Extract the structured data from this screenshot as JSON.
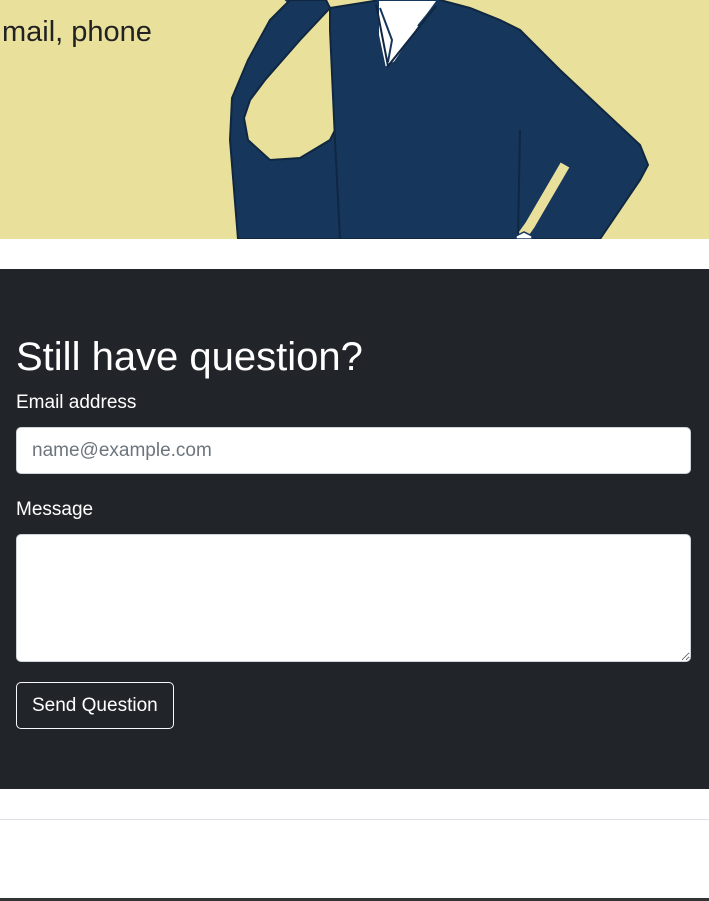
{
  "hero": {
    "text": "mail, phone",
    "illustration_icon": "businessman-on-phone-illustration",
    "colors": {
      "background": "#e9e09c",
      "suit": "#17365b"
    }
  },
  "question_form": {
    "title": "Still have question?",
    "email_label": "Email address",
    "email_placeholder": "name@example.com",
    "email_value": "",
    "message_label": "Message",
    "message_value": "",
    "submit_label": "Send Question",
    "colors": {
      "background": "#212529",
      "text": "#ffffff"
    }
  }
}
